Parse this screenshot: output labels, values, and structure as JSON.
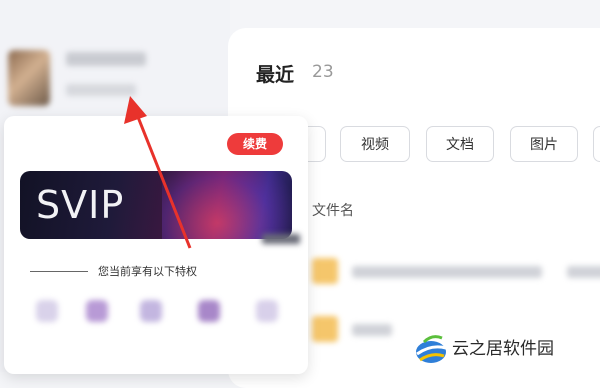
{
  "sidebar": {
    "avatar": "avatar-image"
  },
  "vip_popup": {
    "renew_label": "续费",
    "card_title": "SVIP",
    "benefits_label": "您当前享有以下特权"
  },
  "main": {
    "title": "最近",
    "count": "23",
    "filters": [
      "视频",
      "文档",
      "图片"
    ],
    "column_header": "文件名"
  },
  "watermark": {
    "text": "云之居软件园"
  },
  "colors": {
    "renew_red": "#ee3b3b",
    "arrow_red": "#e8322b",
    "file_icon": "#f5c66b"
  }
}
